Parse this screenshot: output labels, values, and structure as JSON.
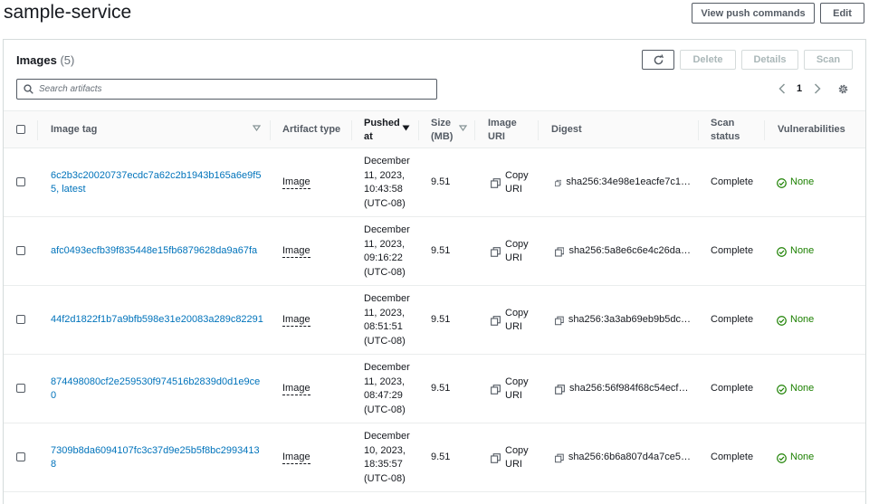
{
  "header": {
    "title": "sample-service",
    "view_push_label": "View push commands",
    "edit_label": "Edit"
  },
  "panel": {
    "title": "Images",
    "count": "(5)",
    "delete_label": "Delete",
    "details_label": "Details",
    "scan_label": "Scan",
    "search_placeholder": "Search artifacts",
    "page_number": "1"
  },
  "columns": {
    "image_tag": "Image tag",
    "artifact_type": "Artifact type",
    "pushed_at": "Pushed at",
    "size": "Size (MB)",
    "image_uri": "Image URI",
    "digest": "Digest",
    "scan_status": "Scan status",
    "vulnerabilities": "Vulnerabilities"
  },
  "rows": [
    {
      "tag": "6c2b3c20020737ecdc7a62c2b1943b165a6e9f55, latest",
      "type": "Image",
      "pushed_1": "December",
      "pushed_2": "11, 2023,",
      "pushed_3": "10:43:58",
      "pushed_4": "(UTC-08)",
      "size": "9.51",
      "uri": "Copy URI",
      "digest": "sha256:34e98e1eacfe7c1…",
      "scan": "Complete",
      "vuln": "None"
    },
    {
      "tag": "afc0493ecfb39f835448e15fb6879628da9a67fa",
      "type": "Image",
      "pushed_1": "December",
      "pushed_2": "11, 2023,",
      "pushed_3": "09:16:22",
      "pushed_4": "(UTC-08)",
      "size": "9.51",
      "uri": "Copy URI",
      "digest": "sha256:5a8e6c6e4c26da…",
      "scan": "Complete",
      "vuln": "None"
    },
    {
      "tag": "44f2d1822f1b7a9bfb598e31e20083a289c82291",
      "type": "Image",
      "pushed_1": "December",
      "pushed_2": "11, 2023,",
      "pushed_3": "08:51:51",
      "pushed_4": "(UTC-08)",
      "size": "9.51",
      "uri": "Copy URI",
      "digest": "sha256:3a3ab69eb9b5dc…",
      "scan": "Complete",
      "vuln": "None"
    },
    {
      "tag": "874498080cf2e259530f974516b2839d0d1e9ce0",
      "type": "Image",
      "pushed_1": "December",
      "pushed_2": "11, 2023,",
      "pushed_3": "08:47:29",
      "pushed_4": "(UTC-08)",
      "size": "9.51",
      "uri": "Copy URI",
      "digest": "sha256:56f984f68c54ecf…",
      "scan": "Complete",
      "vuln": "None"
    },
    {
      "tag": "7309b8da6094107fc3c37d9e25b5f8bc29934138",
      "type": "Image",
      "pushed_1": "December",
      "pushed_2": "10, 2023,",
      "pushed_3": "18:35:57",
      "pushed_4": "(UTC-08)",
      "size": "9.51",
      "uri": "Copy URI",
      "digest": "sha256:6b6a807d4a7ce5…",
      "scan": "Complete",
      "vuln": "None"
    }
  ],
  "icons": {
    "refresh": "refresh-icon",
    "search": "search-icon",
    "copy": "copy-icon",
    "status_ok": "check-circle-icon",
    "settings": "gear-icon",
    "sort": "caret-down-icon"
  },
  "colors": {
    "link": "#0073bb",
    "success": "#1d8102",
    "border": "#d5dbdb"
  }
}
